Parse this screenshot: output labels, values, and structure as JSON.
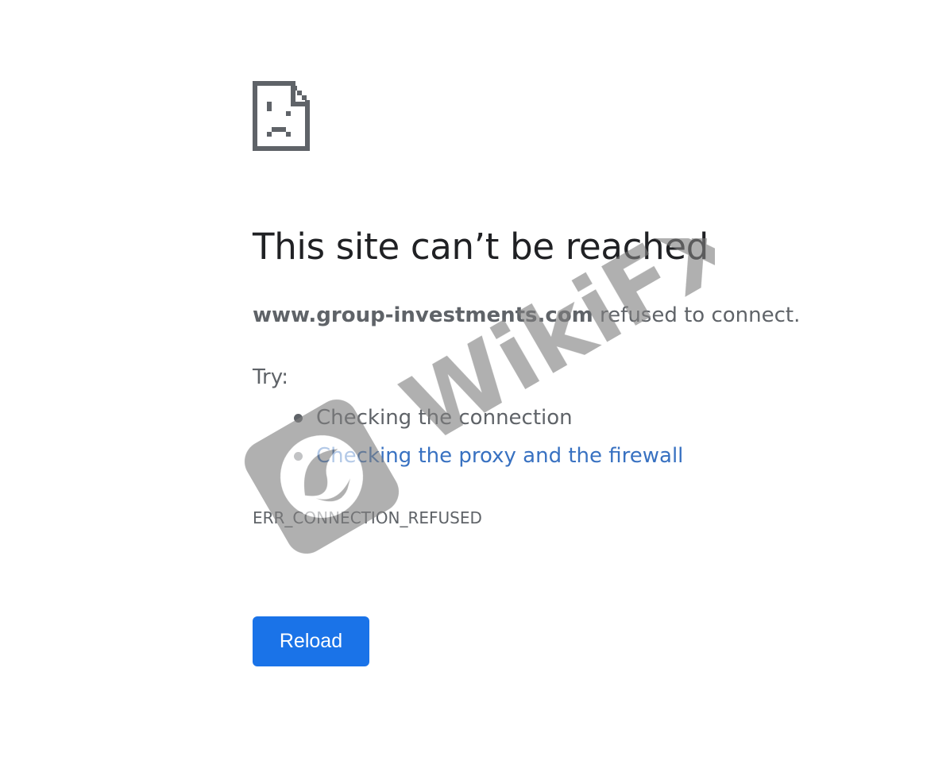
{
  "page": {
    "title": "This site can’t be reached",
    "domain": "www.group-investments.com",
    "message_suffix": " refused to connect.",
    "try_label": "Try:",
    "suggestions": [
      {
        "label": "Checking the connection",
        "is_link": false
      },
      {
        "label": "Checking the proxy and the firewall",
        "is_link": true
      }
    ],
    "error_code": "ERR_CONNECTION_REFUSED",
    "reload_label": "Reload"
  },
  "icons": {
    "sad_page": "sad-page-icon"
  },
  "watermark": {
    "text": "WikiFX"
  },
  "colors": {
    "title": "#202124",
    "text": "#5f6368",
    "link": "#3871c1",
    "button": "#1a73e8",
    "watermark": "#808080"
  }
}
